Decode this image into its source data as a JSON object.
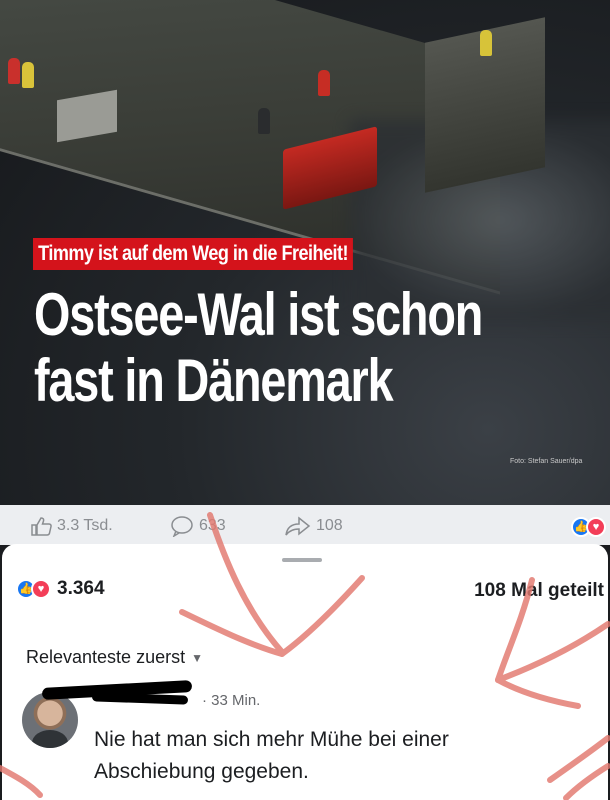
{
  "article": {
    "kicker": "Timmy ist auf dem Weg in die Freiheit!",
    "headline_line1": "Ostsee-Wal ist schon",
    "headline_line2": "fast in Dänemark",
    "photo_credit": "Foto: Stefan Sauer/dpa"
  },
  "action_bar": {
    "likes": "3.3 Tsd.",
    "comments": "633",
    "shares": "108"
  },
  "sheet": {
    "reaction_count": "3.364",
    "share_text": "108 Mal geteilt",
    "sort_label": "Relevanteste zuerst",
    "comment": {
      "time": "· 33 Min.",
      "text": "Nie hat man sich mehr Mühe bei einer Abschiebung gegeben."
    }
  },
  "icons": {
    "like": "thumbs-up-icon",
    "comment": "comment-bubble-icon",
    "share": "share-arrow-icon",
    "reaction_like": "like-reaction-icon",
    "reaction_love": "love-reaction-icon"
  },
  "colors": {
    "kicker_bg": "#d4131b",
    "like_blue": "#1877f2",
    "love_red": "#f33e58",
    "arrow_ink": "#e2786f"
  }
}
